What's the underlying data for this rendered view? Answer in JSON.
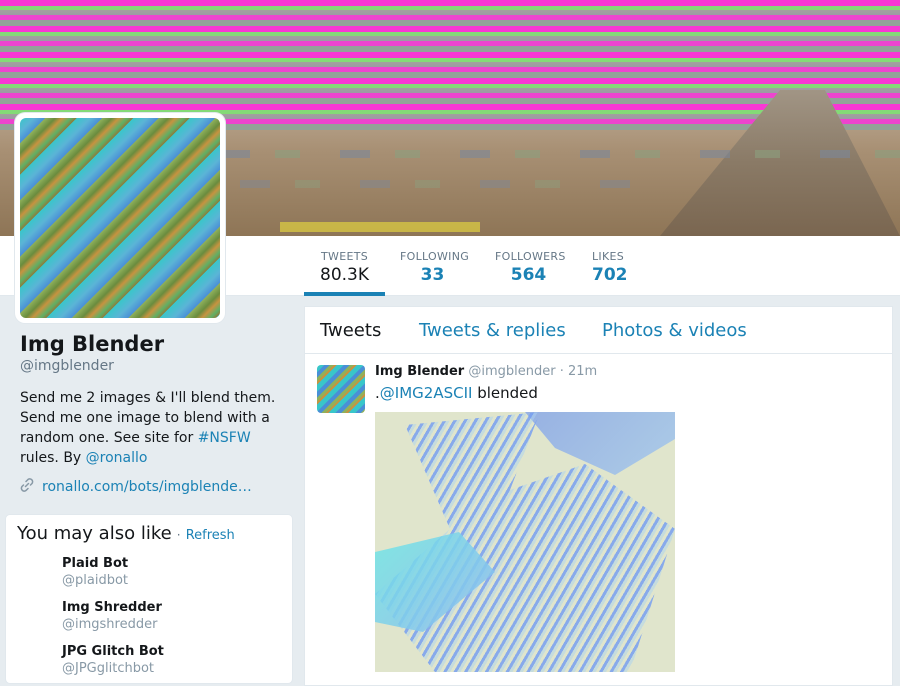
{
  "profile": {
    "name": "Img Blender",
    "handle": "@imgblender",
    "bio_parts": {
      "line1": "Send me 2 images & I'll blend them. Send me one image to blend with a random one. See site for ",
      "hashtag": "#NSFW",
      "line2": " rules. By ",
      "author": "@ronallo"
    },
    "url": "ronallo.com/bots/imgblende…"
  },
  "stats": [
    {
      "label": "Tweets",
      "value": "80.3K"
    },
    {
      "label": "Following",
      "value": "33"
    },
    {
      "label": "Followers",
      "value": "564"
    },
    {
      "label": "Likes",
      "value": "702"
    }
  ],
  "suggestions": {
    "title": "You may also like",
    "separator": "·",
    "refresh": "Refresh",
    "items": [
      {
        "name": "Plaid Bot",
        "handle": "@plaidbot"
      },
      {
        "name": "Img Shredder",
        "handle": "@imgshredder"
      },
      {
        "name": "JPG Glitch Bot",
        "handle": "@JPGglitchbot"
      }
    ]
  },
  "timeline": {
    "tabs": [
      "Tweets",
      "Tweets & replies",
      "Photos & videos"
    ],
    "tweet": {
      "name": "Img Blender",
      "handle": "@imgblender",
      "separator": "·",
      "time": "21m",
      "text_prefix": ".",
      "mention": "@IMG2ASCII",
      "text_suffix": " blended"
    }
  },
  "colors": {
    "accent": "#1b82b5",
    "background": "#e6ecf0"
  }
}
